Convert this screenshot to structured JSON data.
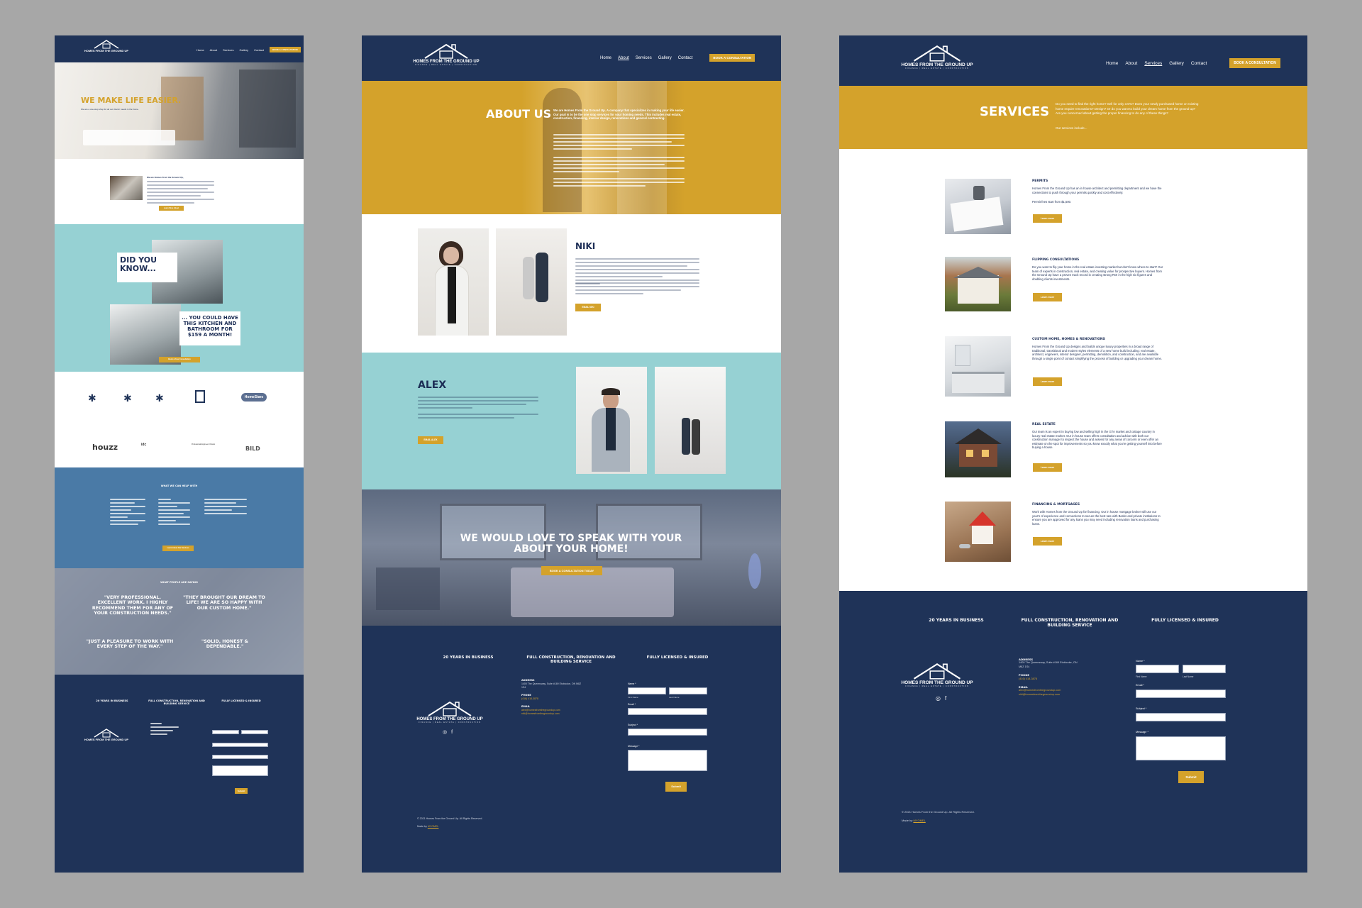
{
  "brand": {
    "name": "HOMES FROM THE GROUND UP",
    "tagline": "FINANCE | REAL ESTATE | CONSTRUCTION"
  },
  "nav": {
    "items": [
      "Home",
      "About",
      "Services",
      "Gallery",
      "Contact"
    ],
    "cta": "BOOK A CONSULTATION"
  },
  "home": {
    "hero_title": "WE MAKE LIFE EASIER.",
    "hero_sub": "We are a one-stop shop for all our clients' needs in the home.",
    "intro_lead": "We are Homes From the Ground Up,",
    "intro_btn": "Learn More About",
    "did_you_know": "DID YOU KNOW...",
    "kitchen_claim": "... YOU COULD HAVE THIS KITCHEN AND BATHROOM FOR $159 A MONTH!",
    "consult_btn": "Book a Free Consultation",
    "logos": [
      "HomeStars",
      "houzz",
      "idc",
      "Professional Engineers Ontario",
      "BILD"
    ],
    "help_title": "WHAT WE CAN HELP WITH",
    "help_btn": "Learn About Our Services",
    "testimonials_title": "WHAT PEOPLE ARE SAYING",
    "testimonials": [
      "\"VERY PROFESSIONAL. EXCELLENT WORK. I HIGHLY RECOMMEND THEM FOR ANY OF YOUR CONSTRUCTION NEEDS.\"",
      "\"THEY BROUGHT OUR DREAM TO LIFE! WE ARE SO HAPPY WITH OUR CUSTOM HOME.\"",
      "\"JUST A PLEASURE TO WORK WITH EVERY STEP OF THE WAY.\"",
      "\"SOLID, HONEST & DEPENDABLE.\""
    ]
  },
  "about": {
    "title": "ABOUT US",
    "intro": "We are Homes From the Ground Up. A company that specializes in making your life easier. Our goal is to be the one stop services for your homing needs. This includes real estate, construction, financing, interior design, renovations and general contracting.",
    "niki_name": "NIKI",
    "niki_btn": "EMAIL NIKI",
    "alex_name": "ALEX",
    "alex_btn": "EMAIL ALEX",
    "cta_title": "WE WOULD LOVE TO SPEAK WITH YOUR ABOUT YOUR HOME!",
    "cta_btn": "BOOK A CONSULTATION TODAY"
  },
  "services": {
    "title": "SERVICES",
    "intro": "Do you need to find the right home? Sell for only 3.5%? Does your newly purchased home or existing home require renovations? Design? Or do you want to build your dream home from the ground up? Are you concerned about getting the proper financing to do any of these things?",
    "intro2": "Our services include...",
    "items": [
      {
        "title": "PERMITS",
        "text": "Homes From the Ground Up has an in house architect and permitting department and we have the connections to push through your permits quickly and cost effectively.",
        "note": "Permit fees start from $1,500.",
        "btn": "Learn more"
      },
      {
        "title": "FLIPPING CONSULTATIONS",
        "text": "Do you want to flip your home in the real estate investing market but don't know where to start? Our team of experts in construction, real estate, and creating value for prospective buyers. Homes from the Ground Up have a proven track record in creating strong ROI in the high six figures and doubling clients investments.",
        "btn": "Learn more"
      },
      {
        "title": "CUSTOM HOME, HOMES & RENOVATIONS",
        "text": "Homes From the Ground Up designs and builds unique luxury properties in a broad range of traditional, transitional and modern styles elements of a new home build including: real estate, architect, engineers, interior designer, permitting, demolition, and construction, and are available through a single point of contact simplifying the process of building or upgrading your dream home.",
        "btn": "Learn more"
      },
      {
        "title": "REAL ESTATE",
        "text": "Our team is an expert in buying low and selling high in the GTA market and cottage country in luxury real estate market. Our in house team offers consultation and advice with both our construction manager to inspect the house and assess for any areas of concern or even offer an estimate on the spot for improvements so you know exactly what you're getting yourself into before buying a house.",
        "btn": "Learn more"
      },
      {
        "title": "FINANCING & MORTGAGES",
        "text": "Work with Homes from the Ground Up for financing. Our in house mortgage broker will use our year's of experience and connections to secure the best rate with Banks and private institutions to ensure you are approved for any loans you may need including renovation loans and purchasing loans.",
        "btn": "Learn more"
      }
    ]
  },
  "footer": {
    "stats": [
      "20 YEARS IN BUSINESS",
      "FULL CONSTRUCTION, RENOVATION  AND BUILDING SERVICE",
      "FULLY LICENSED & INSURED"
    ],
    "address_label": "ADDRESS",
    "address": "1400 The Queensway, Suite #169 Etobicoke, ON M8Z 1S4",
    "phone_label": "PHONE",
    "phone": "(416) 418-3878",
    "email_label": "EMAIL",
    "emails": [
      "alex@homesfromthegroundup.com",
      "niki@homesfromthegroundup.com"
    ],
    "form": {
      "name": "Name *",
      "first": "First Name",
      "last": "Last Name",
      "email": "Email *",
      "subject": "Subject *",
      "message": "Message *",
      "submit": "Submit"
    },
    "copyright": "© 2021 Homes From the Ground Up. All Rights Reserved.",
    "made_by_prefix": "Made by ",
    "made_by": "MYOMEL"
  },
  "colors": {
    "navy": "#1f3358",
    "gold": "#d4a22b",
    "teal": "#96d1d3",
    "steel": "#4a7aa6"
  }
}
